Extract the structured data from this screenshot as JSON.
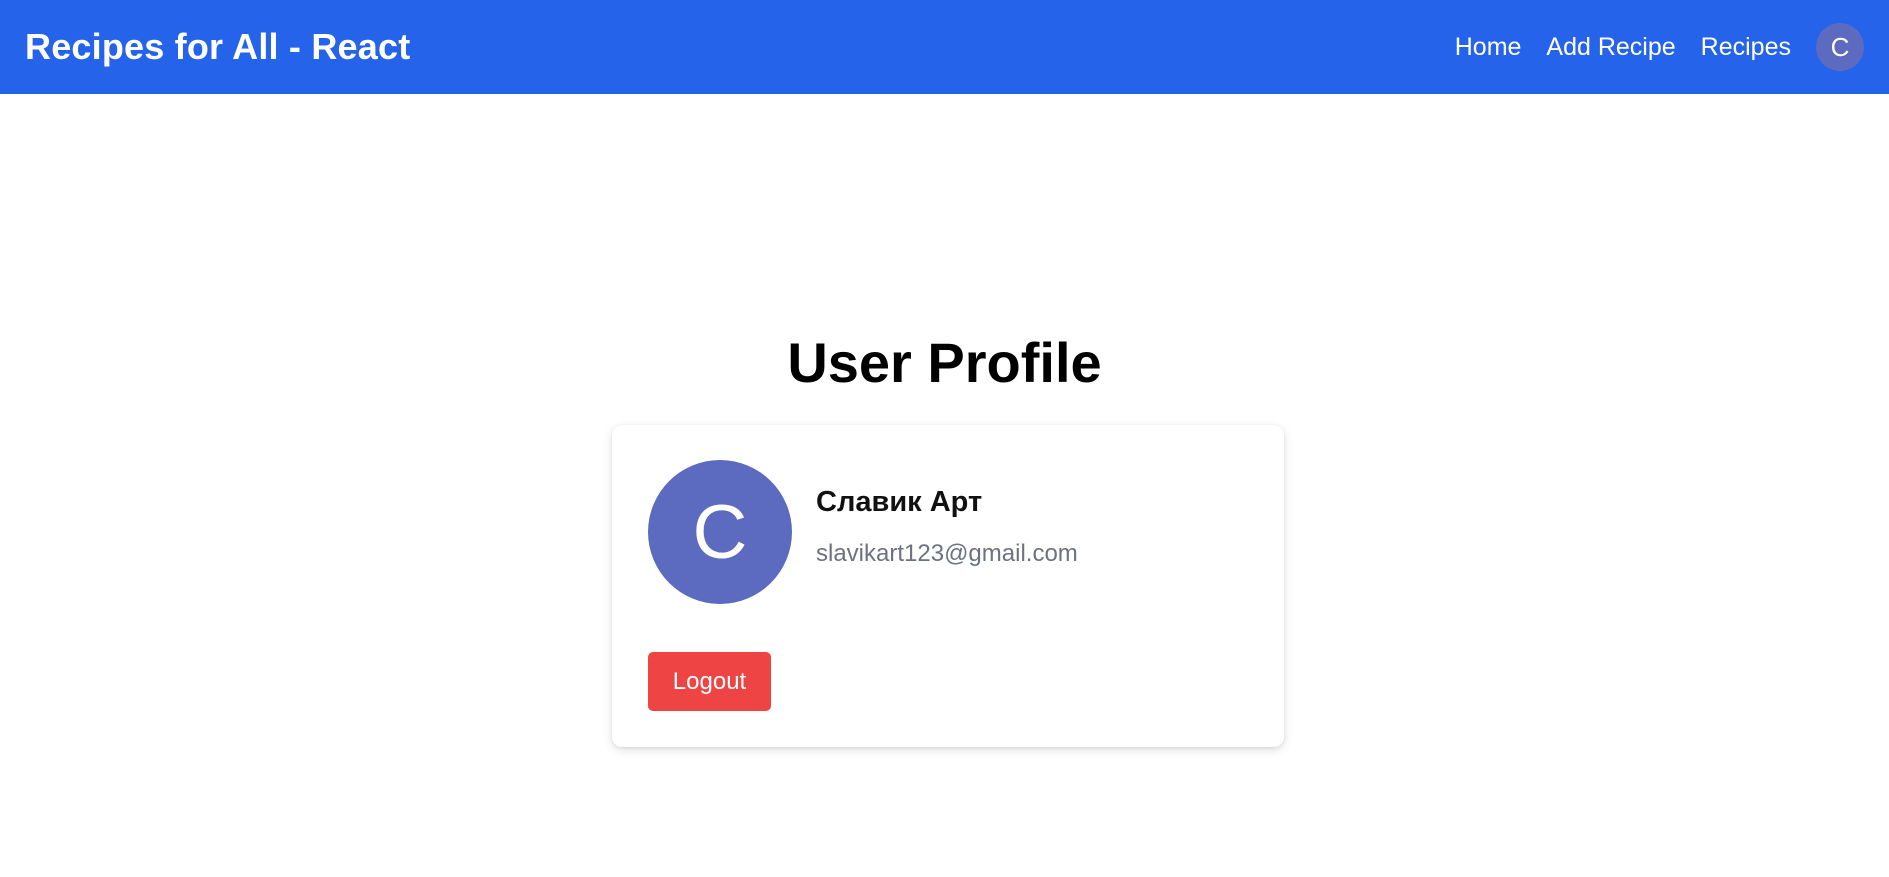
{
  "navbar": {
    "brand": "Recipes for All - React",
    "links": [
      "Home",
      "Add Recipe",
      "Recipes"
    ],
    "avatar_initial": "C",
    "background_color": "#2563eb"
  },
  "main": {
    "title": "User Profile",
    "profile": {
      "avatar_initial": "C",
      "avatar_color": "#5c6bc0",
      "name": "Славик Арт",
      "email": "slavikart123@gmail.com"
    },
    "logout_label": "Logout",
    "logout_color": "#ef4444"
  }
}
